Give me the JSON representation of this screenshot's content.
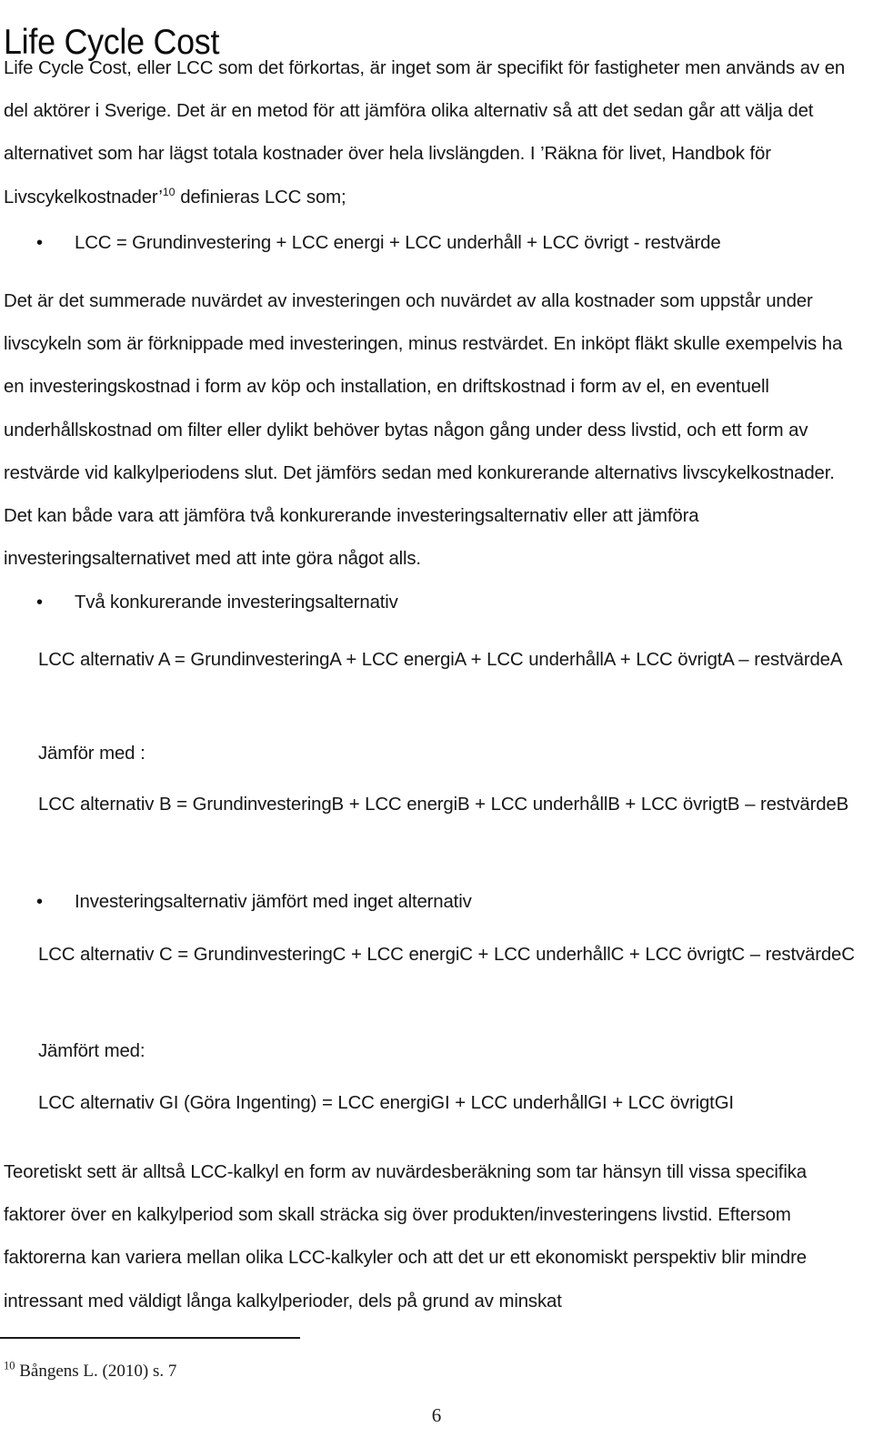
{
  "document": {
    "title": "Life Cycle Cost",
    "page_number": "6",
    "footnote_marker": "10",
    "footnote_text": "Bångens L.  (2010) s. 7",
    "inline_footnote_marker": "10"
  },
  "paragraphs": {
    "intro_part1": "Life Cycle Cost, eller LCC som det förkortas, är inget som är specifikt för fastigheter men används av en del aktörer i Sverige. Det är en metod för att jämföra olika alternativ så att det sedan går att välja det alternativet som har lägst totala kostnader över hela livslängden. I ’Räkna för livet, Handbok för Livscykelkostnader’",
    "intro_part2": " definieras LCC som;",
    "definition_bullet": "LCC = Grundinvestering + LCC energi + LCC underhåll + LCC övrigt - restvärde",
    "explanation": "Det är det summerade nuvärdet av investeringen och nuvärdet av alla kostnader som uppstår under livscykeln som är förknippade med investeringen, minus restvärdet. En inköpt fläkt skulle exempelvis ha en investeringskostnad i form av köp och installation, en driftskostnad i form av el, en eventuell underhållskostnad om filter eller dylikt behöver bytas någon gång under dess livstid, och ett form av restvärde vid kalkylperiodens slut. Det jämförs sedan med konkurerande alternativs livscykelkostnader. Det kan både vara att jämföra  två konkurerande investeringsalternativ eller att jämföra investeringsalternativet med att inte göra något alls.",
    "bullet_two_alternatives": "Två konkurerande investeringsalternativ",
    "formula_a": "LCC alternativ A = GrundinvesteringA + LCC energiA + LCC underhållA + LCC övrigtA – restvärdeA",
    "compare_with_a": "Jämför med :",
    "formula_b": "LCC alternativ B = GrundinvesteringB + LCC energiB + LCC underhållB + LCC övrigtB – restvärdeB",
    "bullet_no_alternative": "Investeringsalternativ jämfört med inget alternativ",
    "formula_c": "LCC alternativ C = GrundinvesteringC + LCC energiC + LCC underhållC + LCC övrigtC – restvärdeC",
    "compare_with_c": "Jämfört med:",
    "formula_gi": "LCC alternativ GI (Göra Ingenting) = LCC energiGI + LCC underhållGI + LCC övrigtGI",
    "closing": "Teoretiskt sett är alltså LCC-kalkyl en form av nuvärdesberäkning som tar hänsyn till vissa specifika faktorer över en kalkylperiod som skall sträcka sig över produkten/investeringens livstid. Eftersom faktorerna kan variera mellan olika LCC-kalkyler och att det ur ett ekonomiskt perspektiv blir mindre intressant med väldigt långa kalkylperioder, dels på grund av minskat"
  },
  "bullet_glyph": "•",
  "colors": {
    "text": "#161616",
    "background": "#ffffff",
    "rule": "#1a1a1a"
  }
}
